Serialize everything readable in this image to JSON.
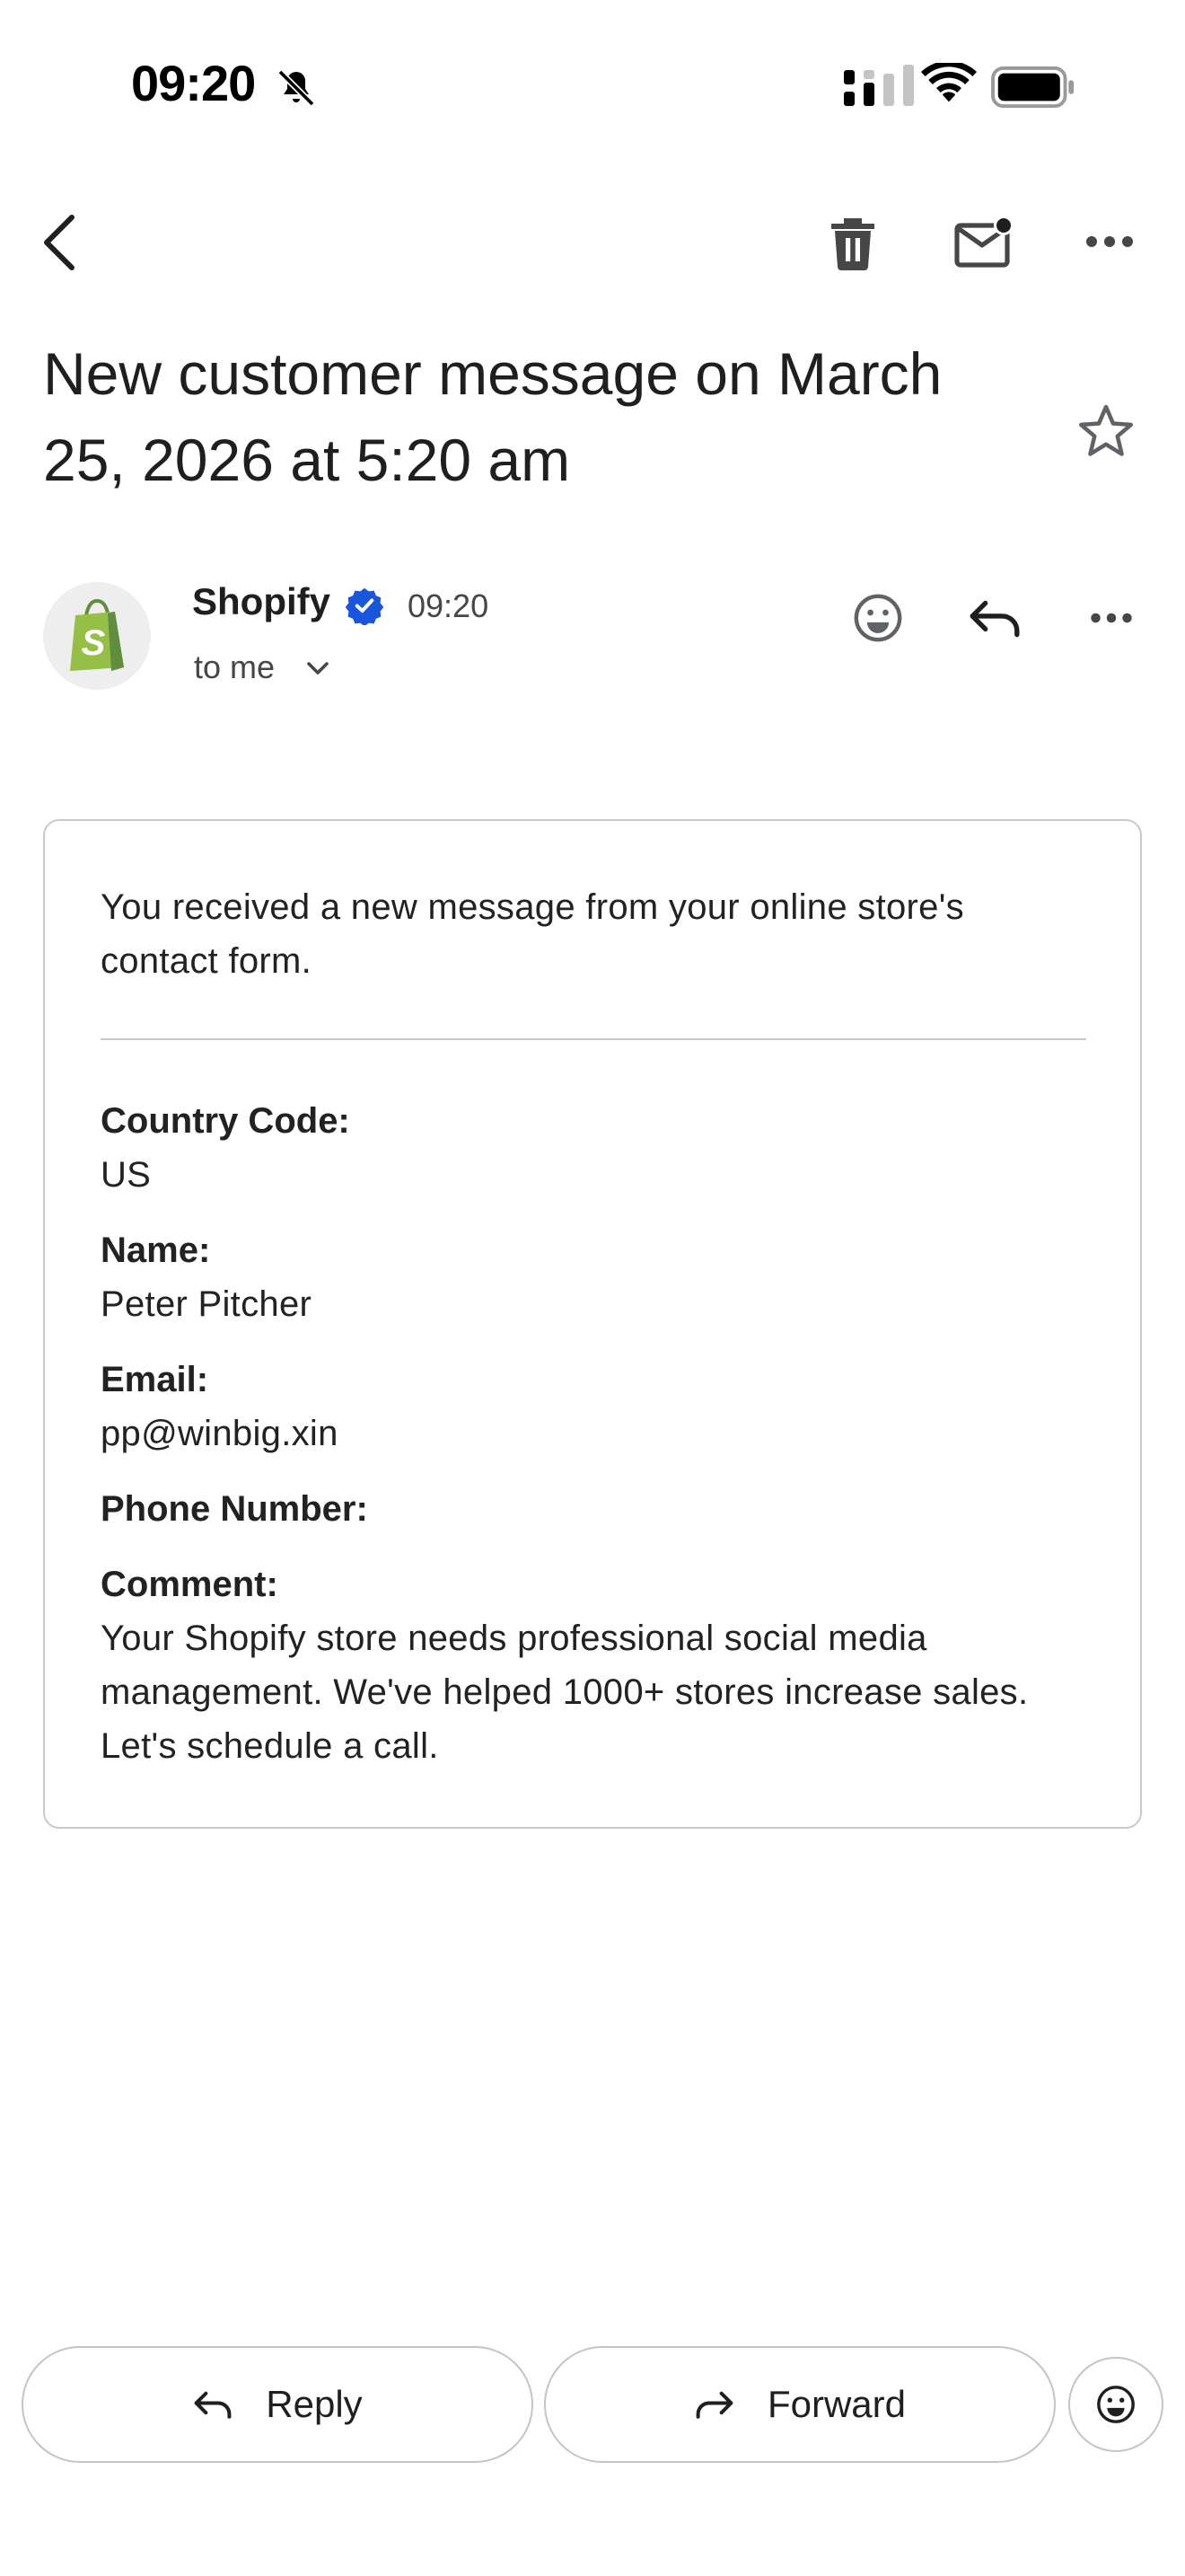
{
  "status_bar": {
    "time": "09:20",
    "icons": [
      "bell-off-icon",
      "cellular-signal-icon",
      "wifi-icon",
      "battery-icon"
    ]
  },
  "toolbar": {
    "icons": [
      "back-arrow-icon",
      "trash-icon",
      "mark-unread-icon",
      "more-horizontal-icon"
    ]
  },
  "email": {
    "subject": "New customer message on March 25, 2026 at 5:20 am",
    "sender": {
      "name": "Shopify",
      "time": "09:20",
      "recipient_label": "to me"
    },
    "body": {
      "intro": "You received a new message from your online store's contact form.",
      "fields": [
        {
          "label": "Country Code:",
          "value": "US"
        },
        {
          "label": "Name:",
          "value": "Peter Pitcher"
        },
        {
          "label": "Email:",
          "value": "pp@winbig.xin"
        },
        {
          "label": "Phone Number:",
          "value": ""
        },
        {
          "label": "Comment:",
          "value": "Your Shopify store needs professional social media management. We've helped 1000+ stores increase sales. Let's schedule a call."
        }
      ]
    }
  },
  "actions": {
    "reply_label": "Reply",
    "forward_label": "Forward"
  },
  "colors": {
    "shopify_green": "#95BF47",
    "verified_blue": "#1A56DB",
    "text_primary": "#1f1f1f",
    "text_secondary": "#444746",
    "border": "#c9c9c9"
  }
}
